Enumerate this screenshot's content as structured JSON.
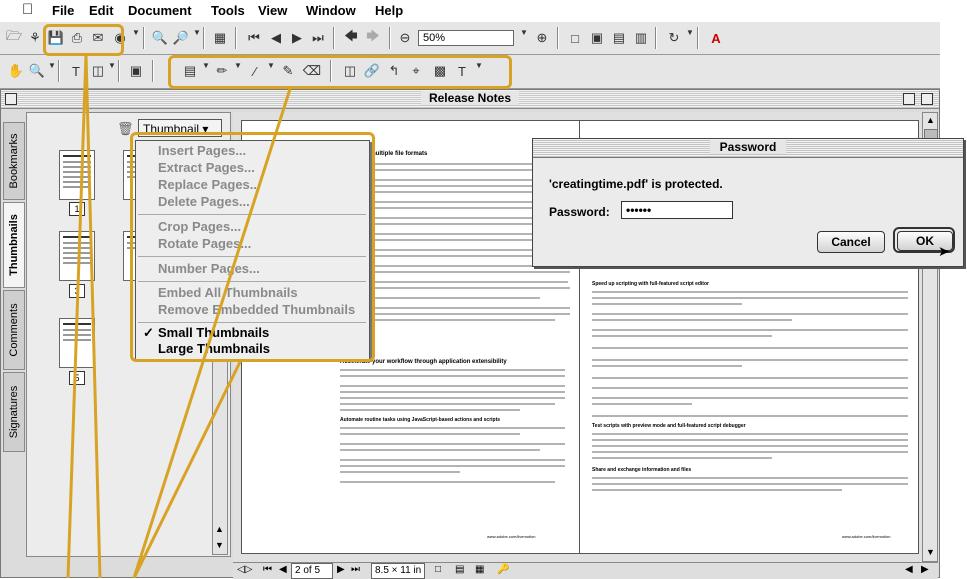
{
  "menubar": {
    "items": [
      "File",
      "Edit",
      "Document",
      "Tools",
      "View",
      "Window",
      "Help"
    ]
  },
  "toolbar": {
    "zoom_value": "50%"
  },
  "window": {
    "title": "Release Notes"
  },
  "side_tabs": [
    "Bookmarks",
    "Thumbnails",
    "Comments",
    "Signatures"
  ],
  "thumb_pane": {
    "dropdown_label": "Thumbnail ▾",
    "page_numbers": [
      "1",
      "3",
      "5"
    ]
  },
  "thumb_menu": {
    "items": [
      {
        "label": "Insert Pages...",
        "enabled": false
      },
      {
        "label": "Extract Pages...",
        "enabled": false
      },
      {
        "label": "Replace Pages...",
        "enabled": false
      },
      {
        "label": "Delete Pages...",
        "enabled": false
      },
      {
        "label": "Crop Pages...",
        "enabled": false
      },
      {
        "label": "Rotate Pages...",
        "enabled": false
      },
      {
        "label": "Number Pages...",
        "enabled": false
      },
      {
        "label": "Embed All Thumbnails",
        "enabled": false
      },
      {
        "label": "Remove Embedded Thumbnails",
        "enabled": false
      },
      {
        "label": "Small Thumbnails",
        "enabled": true,
        "checked": true
      },
      {
        "label": "Large Thumbnails",
        "enabled": true
      }
    ],
    "check_mark": "✓"
  },
  "dialog": {
    "title": "Password",
    "message": "'creatingtime.pdf' is protected.",
    "password_label": "Password:",
    "password_value": "••••••",
    "cancel_label": "Cancel",
    "ok_label": "OK"
  },
  "document": {
    "left_heading": "Import multiple file formats",
    "left_section": "Accelerate your workflow through application extensibility",
    "left_sub1": "Automate routine tasks using JavaScript-based actions and scripts",
    "right_heading": "Speed up scripting with full-featured script editor",
    "right_sub1": "Test scripts with preview mode and full-featured script debugger",
    "right_sub2": "Share and exchange information and files",
    "footer": "www.adobe.com/livemotion"
  },
  "statusbar": {
    "page": "2 of 5",
    "page_size": "8.5 × 11 in"
  },
  "colors": {
    "callout": "#d8a324",
    "menu_bg": "#eeeeee",
    "window_bg": "#dcdcdc"
  }
}
